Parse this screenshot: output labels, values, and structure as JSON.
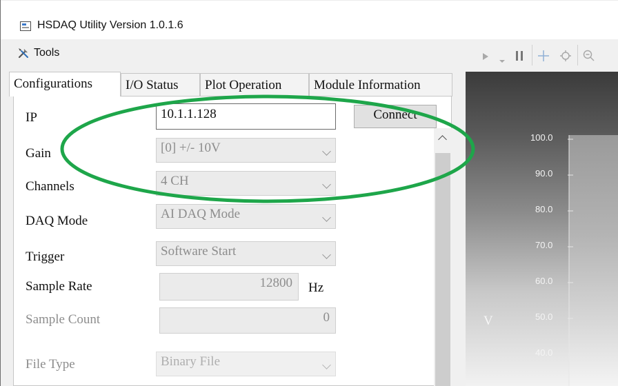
{
  "window": {
    "title": "HSDAQ Utility Version 1.0.1.6",
    "title_icon": "app-window-icon"
  },
  "menu": {
    "tools_label": "Tools",
    "tools_icon": "tools-icon"
  },
  "tabs": [
    {
      "label": "Configurations",
      "active": true
    },
    {
      "label": "I/O Status",
      "active": false
    },
    {
      "label": "Plot Operation",
      "active": false
    },
    {
      "label": "Module Information",
      "active": false
    }
  ],
  "config": {
    "ip_label": "IP",
    "ip_value": "10.1.1.128",
    "connect_label": "Connect",
    "gain_label": "Gain",
    "gain_value": "[0] +/- 10V",
    "channels_label": "Channels",
    "channels_value": "4 CH",
    "daq_mode_label": "DAQ Mode",
    "daq_mode_value": "AI DAQ Mode",
    "trigger_label": "Trigger",
    "trigger_value": "Software Start",
    "sample_rate_label": "Sample Rate",
    "sample_rate_value": "12800",
    "sample_rate_unit": "Hz",
    "sample_count_label": "Sample Count",
    "sample_count_value": "0",
    "file_type_label": "File Type",
    "file_type_value": "Binary File"
  },
  "plot": {
    "y_axis_label": "V",
    "y_ticks": [
      "100.0",
      "90.0",
      "80.0",
      "70.0",
      "60.0",
      "50.0",
      "40.0"
    ],
    "toolbar_icons": [
      "play-icon",
      "dropdown-arrow-icon",
      "pause-icon",
      "pan-icon",
      "zoom-point-icon",
      "zoom-out-icon"
    ]
  },
  "colors": {
    "highlight_ellipse": "#1ea64a",
    "window_bg": "#f0f0f0",
    "disabled_text": "#8d8d8d"
  }
}
